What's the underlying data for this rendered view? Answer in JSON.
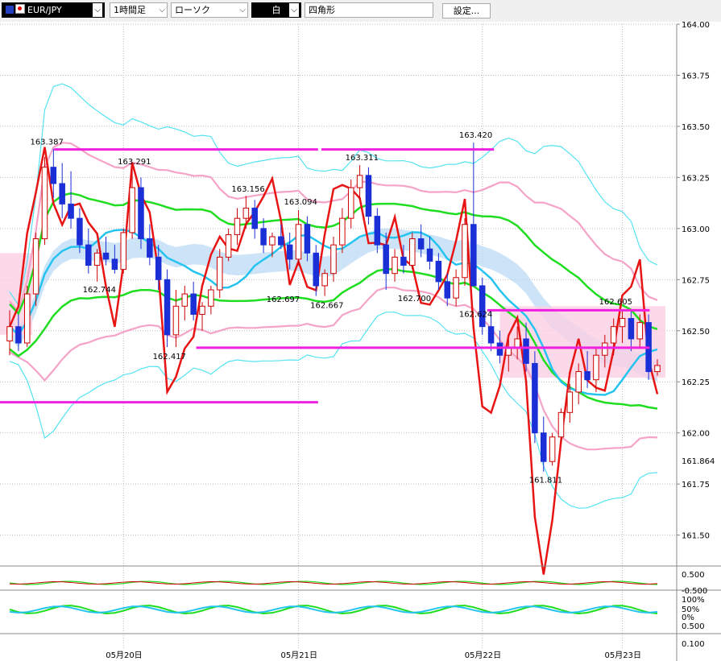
{
  "toolbar": {
    "symbol": "EUR/JPY",
    "timeframe": "1時間足",
    "chart_style": "ローソク",
    "color_mode": "白",
    "drawing_tool": "四角形",
    "settings_label": "設定..."
  },
  "colors": {
    "bull": "#cc0000",
    "bear": "#1a2fd6",
    "bb_outer": "#55e2f2",
    "bb_middle": "#f5a3c7",
    "envelope": "#1fdd1f",
    "sma": "#25c4f0",
    "rci": "#e81414",
    "cloud": "#b8d8f5",
    "horizontal_lines": "#f020e0",
    "zone": "#fbd0e4"
  },
  "chart_data": {
    "type": "candlestick",
    "ylim": [
      161.4,
      164.0
    ],
    "y_ticks": [
      "164.00",
      "163.75",
      "163.50",
      "163.25",
      "163.00",
      "162.75",
      "162.50",
      "162.25",
      "162.00",
      "161.75",
      "161.50"
    ],
    "x_ticks": [
      "05月20日",
      "05月21日",
      "05月22日",
      "05月23日"
    ],
    "current_price": "161.864",
    "annotations": [
      {
        "text": "163.387",
        "value": 163.387
      },
      {
        "text": "163.291",
        "value": 163.291
      },
      {
        "text": "162.744",
        "value": 162.744
      },
      {
        "text": "162.417",
        "value": 162.417
      },
      {
        "text": "163.156",
        "value": 163.156
      },
      {
        "text": "163.094",
        "value": 163.094
      },
      {
        "text": "162.697",
        "value": 162.697
      },
      {
        "text": "162.667",
        "value": 162.667
      },
      {
        "text": "163.311",
        "value": 163.311
      },
      {
        "text": "162.700",
        "value": 162.7
      },
      {
        "text": "163.420",
        "value": 163.42
      },
      {
        "text": "162.624",
        "value": 162.624
      },
      {
        "text": "161.811",
        "value": 161.811
      },
      {
        "text": "162.605",
        "value": 162.605
      }
    ],
    "candles": [
      [
        162.45,
        162.6,
        162.38,
        162.52
      ],
      [
        162.52,
        162.58,
        162.4,
        162.44
      ],
      [
        162.44,
        162.72,
        162.42,
        162.68
      ],
      [
        162.68,
        162.98,
        162.62,
        162.95
      ],
      [
        162.95,
        163.35,
        162.92,
        163.3
      ],
      [
        163.3,
        163.39,
        163.15,
        163.22
      ],
      [
        163.22,
        163.32,
        163.05,
        163.12
      ],
      [
        163.12,
        163.28,
        163.0,
        163.05
      ],
      [
        163.05,
        163.1,
        162.88,
        162.92
      ],
      [
        162.92,
        163.0,
        162.78,
        162.82
      ],
      [
        162.82,
        162.9,
        162.74,
        162.88
      ],
      [
        162.88,
        162.96,
        162.82,
        162.85
      ],
      [
        162.85,
        162.92,
        162.78,
        162.8
      ],
      [
        162.8,
        163.0,
        162.78,
        162.98
      ],
      [
        162.98,
        163.29,
        162.95,
        163.2
      ],
      [
        163.2,
        163.25,
        162.9,
        162.95
      ],
      [
        162.95,
        163.02,
        162.82,
        162.86
      ],
      [
        162.86,
        162.92,
        162.7,
        162.75
      ],
      [
        162.75,
        162.8,
        162.42,
        162.48
      ],
      [
        162.48,
        162.7,
        162.42,
        162.62
      ],
      [
        162.62,
        162.72,
        162.55,
        162.68
      ],
      [
        162.68,
        162.74,
        162.55,
        162.58
      ],
      [
        162.58,
        162.64,
        162.5,
        162.62
      ],
      [
        162.62,
        162.72,
        162.58,
        162.7
      ],
      [
        162.7,
        162.9,
        162.66,
        162.86
      ],
      [
        162.86,
        163.0,
        162.84,
        162.97
      ],
      [
        162.97,
        163.1,
        162.92,
        163.05
      ],
      [
        163.05,
        163.16,
        163.0,
        163.1
      ],
      [
        163.1,
        163.14,
        162.95,
        163.0
      ],
      [
        163.0,
        163.05,
        162.88,
        162.92
      ],
      [
        162.92,
        162.98,
        162.86,
        162.96
      ],
      [
        162.96,
        163.02,
        162.9,
        162.92
      ],
      [
        162.92,
        162.98,
        162.8,
        162.85
      ],
      [
        162.85,
        163.09,
        162.82,
        163.02
      ],
      [
        163.02,
        163.06,
        162.84,
        162.88
      ],
      [
        162.88,
        162.92,
        162.67,
        162.72
      ],
      [
        162.72,
        162.8,
        162.67,
        162.78
      ],
      [
        162.78,
        162.96,
        162.74,
        162.92
      ],
      [
        162.92,
        163.1,
        162.88,
        163.05
      ],
      [
        163.05,
        163.24,
        163.0,
        163.2
      ],
      [
        163.2,
        163.31,
        163.14,
        163.26
      ],
      [
        163.26,
        163.3,
        163.02,
        163.06
      ],
      [
        163.06,
        163.1,
        162.88,
        162.92
      ],
      [
        162.92,
        162.98,
        162.7,
        162.78
      ],
      [
        162.78,
        162.9,
        162.74,
        162.86
      ],
      [
        162.86,
        162.92,
        162.78,
        162.82
      ],
      [
        162.82,
        162.98,
        162.8,
        162.95
      ],
      [
        162.95,
        163.02,
        162.86,
        162.9
      ],
      [
        162.9,
        162.96,
        162.8,
        162.84
      ],
      [
        162.84,
        162.88,
        162.7,
        162.74
      ],
      [
        162.74,
        162.78,
        162.62,
        162.66
      ],
      [
        162.66,
        162.8,
        162.62,
        162.76
      ],
      [
        162.76,
        163.05,
        162.72,
        163.02
      ],
      [
        163.02,
        163.42,
        162.95,
        162.72
      ],
      [
        162.72,
        162.76,
        162.48,
        162.52
      ],
      [
        162.52,
        162.6,
        162.4,
        162.44
      ],
      [
        162.44,
        162.5,
        162.34,
        162.38
      ],
      [
        162.38,
        162.46,
        162.3,
        162.42
      ],
      [
        162.42,
        162.52,
        162.36,
        162.46
      ],
      [
        162.46,
        162.54,
        162.3,
        162.34
      ],
      [
        162.34,
        162.4,
        161.95,
        162.0
      ],
      [
        162.0,
        162.08,
        161.81,
        161.86
      ],
      [
        161.86,
        162.0,
        161.84,
        161.98
      ],
      [
        161.98,
        162.12,
        161.95,
        162.1
      ],
      [
        162.1,
        162.24,
        162.05,
        162.2
      ],
      [
        162.2,
        162.34,
        162.14,
        162.3
      ],
      [
        162.3,
        162.4,
        162.22,
        162.26
      ],
      [
        162.26,
        162.42,
        162.2,
        162.38
      ],
      [
        162.38,
        162.48,
        162.32,
        162.44
      ],
      [
        162.44,
        162.56,
        162.38,
        162.52
      ],
      [
        162.52,
        162.6,
        162.44,
        162.56
      ],
      [
        162.56,
        162.6,
        162.4,
        162.46
      ],
      [
        162.46,
        162.58,
        162.42,
        162.54
      ],
      [
        162.54,
        162.58,
        162.26,
        162.3
      ],
      [
        162.3,
        162.36,
        162.28,
        162.33
      ]
    ],
    "hlines": [
      {
        "label": "163.387 line",
        "y": 163.387,
        "x1": 0.08,
        "x2": 0.47
      },
      {
        "label": "163.387 line b",
        "y": 163.387,
        "x1": 0.475,
        "x2": 0.73
      },
      {
        "label": "162.417 line",
        "y": 162.417,
        "x1": 0.29,
        "x2": 0.96
      },
      {
        "label": "162.60 line",
        "y": 162.6,
        "x1": 0.72,
        "x2": 0.96
      },
      {
        "label": "162.15 line",
        "y": 162.15,
        "x1": 0.0,
        "x2": 0.47
      }
    ],
    "lower_panel_labels": [
      "0.500",
      "-0.500",
      "100%",
      "50%",
      "0%",
      "0.500",
      "0.100"
    ]
  }
}
